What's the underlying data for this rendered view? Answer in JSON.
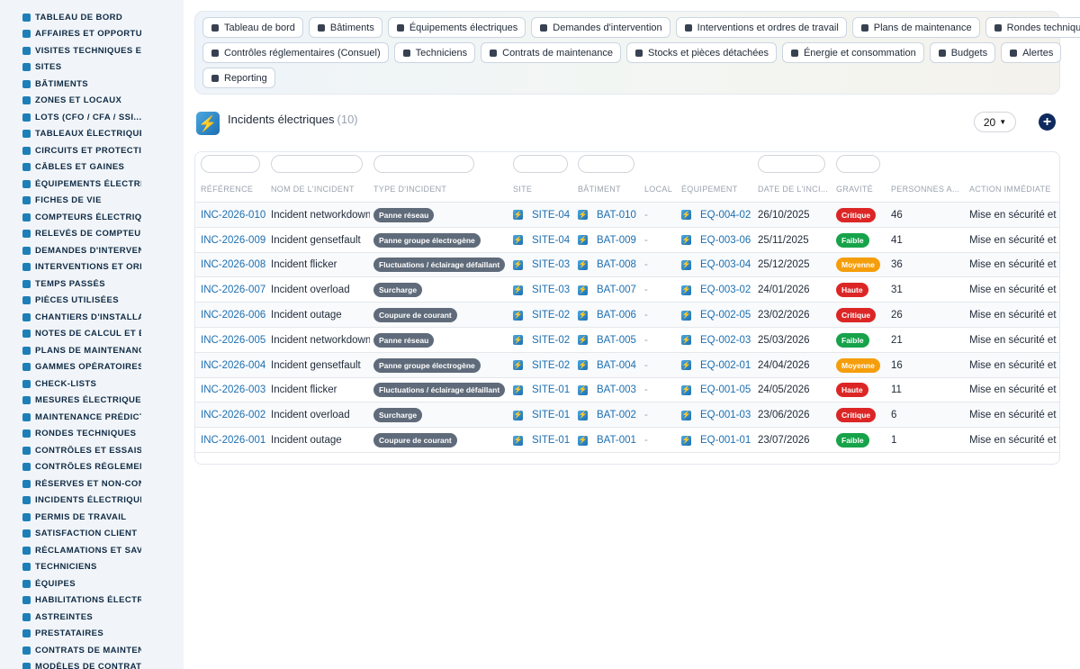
{
  "sidebar": {
    "items": [
      {
        "label": "TABLEAU DE BORD",
        "icon": "dashboard-icon"
      },
      {
        "label": "AFFAIRES ET OPPORTUNITÉS",
        "icon": "target-icon"
      },
      {
        "label": "VISITES TECHNIQUES ET ...",
        "icon": "foot-icon"
      },
      {
        "label": "SITES",
        "icon": "location-pin-icon"
      },
      {
        "label": "BÂTIMENTS",
        "icon": "building-icon"
      },
      {
        "label": "ZONES ET LOCAUX",
        "icon": "grid-icon"
      },
      {
        "label": "LOTS (CFO / CFA / SSI...)",
        "icon": "sitemap-icon"
      },
      {
        "label": "TABLEAUX ÉLECTRIQUES",
        "icon": "table-icon"
      },
      {
        "label": "CIRCUITS ET PROTECTIONS",
        "icon": "plug-icon"
      },
      {
        "label": "CÂBLES ET GAINES",
        "icon": "lines-icon"
      },
      {
        "label": "ÉQUIPEMENTS ÉLECTRIQUES",
        "icon": "cogs-icon"
      },
      {
        "label": "FICHES DE VIE",
        "icon": "history-icon"
      },
      {
        "label": "COMPTEURS ÉLECTRIQUES",
        "icon": "gauge-icon"
      },
      {
        "label": "RELEVÉS DE COMPTEURS",
        "icon": "list-icon"
      },
      {
        "label": "DEMANDES D'INTERVENTION",
        "icon": "question-icon"
      },
      {
        "label": "INTERVENTIONS ET ORDRES DE TRAVAIL",
        "icon": "clipboard-icon"
      },
      {
        "label": "TEMPS PASSÉS",
        "icon": "clock-icon"
      },
      {
        "label": "PIÈCES UTILISÉES",
        "icon": "boxes-icon"
      },
      {
        "label": "CHANTIERS D'INSTALLATION",
        "icon": "hammer-icon"
      },
      {
        "label": "NOTES DE CALCUL ET ÉTUDES",
        "icon": "calculator-icon"
      },
      {
        "label": "PLANS DE MAINTENANCE",
        "icon": "calendar-icon"
      },
      {
        "label": "GAMMES OPÉRATOIRES",
        "icon": "list-ol-icon"
      },
      {
        "label": "CHECK-LISTS",
        "icon": "checklist-icon"
      },
      {
        "label": "MESURES ÉLECTRIQUES",
        "icon": "ruler-icon"
      },
      {
        "label": "MAINTENANCE PRÉDICTIVE",
        "icon": "chart-line-icon"
      },
      {
        "label": "RONDES TECHNIQUES",
        "icon": "route-icon"
      },
      {
        "label": "CONTRÔLES ET ESSAIS",
        "icon": "search-icon"
      },
      {
        "label": "CONTRÔLES RÉGLEMENTAIRES",
        "icon": "file-check-icon"
      },
      {
        "label": "RÉSERVES ET NON-CONFORMITÉS",
        "icon": "exclamation-icon"
      },
      {
        "label": "INCIDENTS ÉLECTRIQUES",
        "icon": "warning-icon"
      },
      {
        "label": "PERMIS DE TRAVAIL",
        "icon": "signature-icon"
      },
      {
        "label": "SATISFACTION CLIENT",
        "icon": "smile-icon"
      },
      {
        "label": "RÉCLAMATIONS ET SAV",
        "icon": "comment-icon"
      },
      {
        "label": "TECHNICIENS",
        "icon": "helmet-icon"
      },
      {
        "label": "ÉQUIPES",
        "icon": "users-icon"
      },
      {
        "label": "HABILITATIONS ÉLECTRIQUES",
        "icon": "certificate-icon"
      },
      {
        "label": "ASTREINTES",
        "icon": "phone-icon"
      },
      {
        "label": "PRESTATAIRES",
        "icon": "handshake-icon"
      },
      {
        "label": "CONTRATS DE MAINTENANCE",
        "icon": "file-contract-icon"
      },
      {
        "label": "MODÈLES DE CONTRATS",
        "icon": "file-icon"
      }
    ]
  },
  "nav": {
    "rows": [
      [
        {
          "label": "Tableau de bord",
          "icon": "dashboard-icon"
        },
        {
          "label": "Bâtiments",
          "icon": "building-icon"
        },
        {
          "label": "Équipements électriques",
          "icon": "cogs-icon"
        },
        {
          "label": "Demandes d'intervention",
          "icon": "question-icon"
        },
        {
          "label": "Interventions et ordres de travail",
          "icon": "clipboard-icon"
        },
        {
          "label": "Plans de maintenance",
          "icon": "calendar-icon"
        },
        {
          "label": "Rondes techniques",
          "icon": "route-icon"
        }
      ],
      [
        {
          "label": "Contrôles réglementaires (Consuel)",
          "icon": "file-check-icon"
        },
        {
          "label": "Techniciens",
          "icon": "helmet-icon"
        },
        {
          "label": "Contrats de maintenance",
          "icon": "file-contract-icon"
        },
        {
          "label": "Stocks et pièces détachées",
          "icon": "boxes-icon"
        },
        {
          "label": "Énergie et consommation",
          "icon": "bolt-icon"
        },
        {
          "label": "Budgets",
          "icon": "money-icon"
        },
        {
          "label": "Alertes",
          "icon": "bell-icon"
        }
      ],
      [
        {
          "label": "Reporting",
          "icon": "chart-pie-icon"
        }
      ]
    ]
  },
  "header": {
    "title": "Incidents électriques",
    "count": "(10)",
    "per_page": "20"
  },
  "table": {
    "columns": [
      "RÉFÉRENCE",
      "NOM DE L'INCIDENT",
      "TYPE D'INCIDENT",
      "SITE",
      "BÂTIMENT",
      "LOCAL",
      "ÉQUIPEMENT",
      "DATE DE L'INCI...",
      "GRAVITÉ",
      "PERSONNES A...",
      "ACTION IMMÉDIATE"
    ],
    "rows": [
      {
        "ref": "INC-2026-010",
        "name": "Incident networkdown",
        "type": "Panne réseau",
        "site": "SITE-04",
        "bat": "BAT-010",
        "local": "-",
        "equip": "EQ-004-02",
        "date": "26/10/2025",
        "sev": "Critique",
        "sev_color": "#dc2626",
        "persons": "46",
        "action": "Mise en sécurité et inf"
      },
      {
        "ref": "INC-2026-009",
        "name": "Incident gensetfault",
        "type": "Panne groupe électrogène",
        "site": "SITE-04",
        "bat": "BAT-009",
        "local": "-",
        "equip": "EQ-003-06",
        "date": "25/11/2025",
        "sev": "Faible",
        "sev_color": "#16a34a",
        "persons": "41",
        "action": "Mise en sécurité et inf"
      },
      {
        "ref": "INC-2026-008",
        "name": "Incident flicker",
        "type": "Fluctuations / éclairage défaillant",
        "site": "SITE-03",
        "bat": "BAT-008",
        "local": "-",
        "equip": "EQ-003-04",
        "date": "25/12/2025",
        "sev": "Moyenne",
        "sev_color": "#f59e0b",
        "persons": "36",
        "action": "Mise en sécurité et inf"
      },
      {
        "ref": "INC-2026-007",
        "name": "Incident overload",
        "type": "Surcharge",
        "site": "SITE-03",
        "bat": "BAT-007",
        "local": "-",
        "equip": "EQ-003-02",
        "date": "24/01/2026",
        "sev": "Haute",
        "sev_color": "#dc2626",
        "persons": "31",
        "action": "Mise en sécurité et inf"
      },
      {
        "ref": "INC-2026-006",
        "name": "Incident outage",
        "type": "Coupure de courant",
        "site": "SITE-02",
        "bat": "BAT-006",
        "local": "-",
        "equip": "EQ-002-05",
        "date": "23/02/2026",
        "sev": "Critique",
        "sev_color": "#dc2626",
        "persons": "26",
        "action": "Mise en sécurité et inf"
      },
      {
        "ref": "INC-2026-005",
        "name": "Incident networkdown",
        "type": "Panne réseau",
        "site": "SITE-02",
        "bat": "BAT-005",
        "local": "-",
        "equip": "EQ-002-03",
        "date": "25/03/2026",
        "sev": "Faible",
        "sev_color": "#16a34a",
        "persons": "21",
        "action": "Mise en sécurité et inf"
      },
      {
        "ref": "INC-2026-004",
        "name": "Incident gensetfault",
        "type": "Panne groupe électrogène",
        "site": "SITE-02",
        "bat": "BAT-004",
        "local": "-",
        "equip": "EQ-002-01",
        "date": "24/04/2026",
        "sev": "Moyenne",
        "sev_color": "#f59e0b",
        "persons": "16",
        "action": "Mise en sécurité et inf"
      },
      {
        "ref": "INC-2026-003",
        "name": "Incident flicker",
        "type": "Fluctuations / éclairage défaillant",
        "site": "SITE-01",
        "bat": "BAT-003",
        "local": "-",
        "equip": "EQ-001-05",
        "date": "24/05/2026",
        "sev": "Haute",
        "sev_color": "#dc2626",
        "persons": "11",
        "action": "Mise en sécurité et inf"
      },
      {
        "ref": "INC-2026-002",
        "name": "Incident overload",
        "type": "Surcharge",
        "site": "SITE-01",
        "bat": "BAT-002",
        "local": "-",
        "equip": "EQ-001-03",
        "date": "23/06/2026",
        "sev": "Critique",
        "sev_color": "#dc2626",
        "persons": "6",
        "action": "Mise en sécurité et inf"
      },
      {
        "ref": "INC-2026-001",
        "name": "Incident outage",
        "type": "Coupure de courant",
        "site": "SITE-01",
        "bat": "BAT-001",
        "local": "-",
        "equip": "EQ-001-01",
        "date": "23/07/2026",
        "sev": "Faible",
        "sev_color": "#16a34a",
        "persons": "1",
        "action": "Mise en sécurité et inf"
      }
    ]
  }
}
